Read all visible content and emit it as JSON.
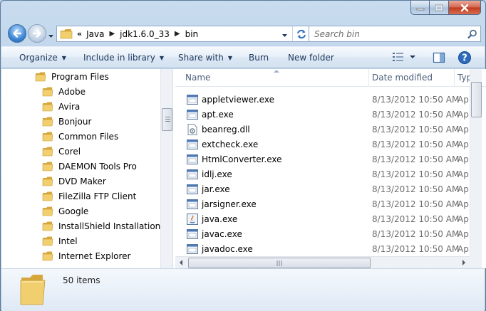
{
  "address": {
    "overflow": "«",
    "crumbs": [
      "Java",
      "jdk1.6.0_33",
      "bin"
    ]
  },
  "search": {
    "placeholder": "Search bin"
  },
  "toolbar": {
    "organize": "Organize",
    "include_in_library": "Include in library",
    "share_with": "Share with",
    "burn": "Burn",
    "new_folder": "New folder"
  },
  "nav": {
    "root": "Program Files",
    "items": [
      "Adobe",
      "Avira",
      "Bonjour",
      "Common Files",
      "Corel",
      "DAEMON Tools Pro",
      "DVD Maker",
      "FileZilla FTP Client",
      "Google",
      "InstallShield Installation Info",
      "Intel",
      "Internet Explorer"
    ]
  },
  "columns": {
    "name": "Name",
    "date_modified": "Date modified",
    "type": "Typ"
  },
  "files": [
    {
      "name": "appletviewer.exe",
      "date": "8/13/2012 10:50 AM",
      "type": "Ap",
      "icon": "exe-icon"
    },
    {
      "name": "apt.exe",
      "date": "8/13/2012 10:50 AM",
      "type": "Ap",
      "icon": "exe-icon"
    },
    {
      "name": "beanreg.dll",
      "date": "8/13/2012 10:50 AM",
      "type": "Ap",
      "icon": "dll-icon"
    },
    {
      "name": "extcheck.exe",
      "date": "8/13/2012 10:50 AM",
      "type": "Ap",
      "icon": "exe-icon"
    },
    {
      "name": "HtmlConverter.exe",
      "date": "8/13/2012 10:50 AM",
      "type": "Ap",
      "icon": "exe-icon"
    },
    {
      "name": "idlj.exe",
      "date": "8/13/2012 10:50 AM",
      "type": "Ap",
      "icon": "exe-icon"
    },
    {
      "name": "jar.exe",
      "date": "8/13/2012 10:50 AM",
      "type": "Ap",
      "icon": "exe-icon"
    },
    {
      "name": "jarsigner.exe",
      "date": "8/13/2012 10:50 AM",
      "type": "Ap",
      "icon": "exe-icon"
    },
    {
      "name": "java.exe",
      "date": "8/13/2012 10:50 AM",
      "type": "Ap",
      "icon": "java-icon"
    },
    {
      "name": "javac.exe",
      "date": "8/13/2012 10:50 AM",
      "type": "Ap",
      "icon": "exe-icon"
    },
    {
      "name": "javadoc.exe",
      "date": "8/13/2012 10:50 AM",
      "type": "Ap",
      "icon": "exe-icon"
    }
  ],
  "status": {
    "item_count": "50 items"
  },
  "colors": {
    "folder": "#e9c25a",
    "accent": "#1e395b",
    "header_text": "#4c607a"
  }
}
